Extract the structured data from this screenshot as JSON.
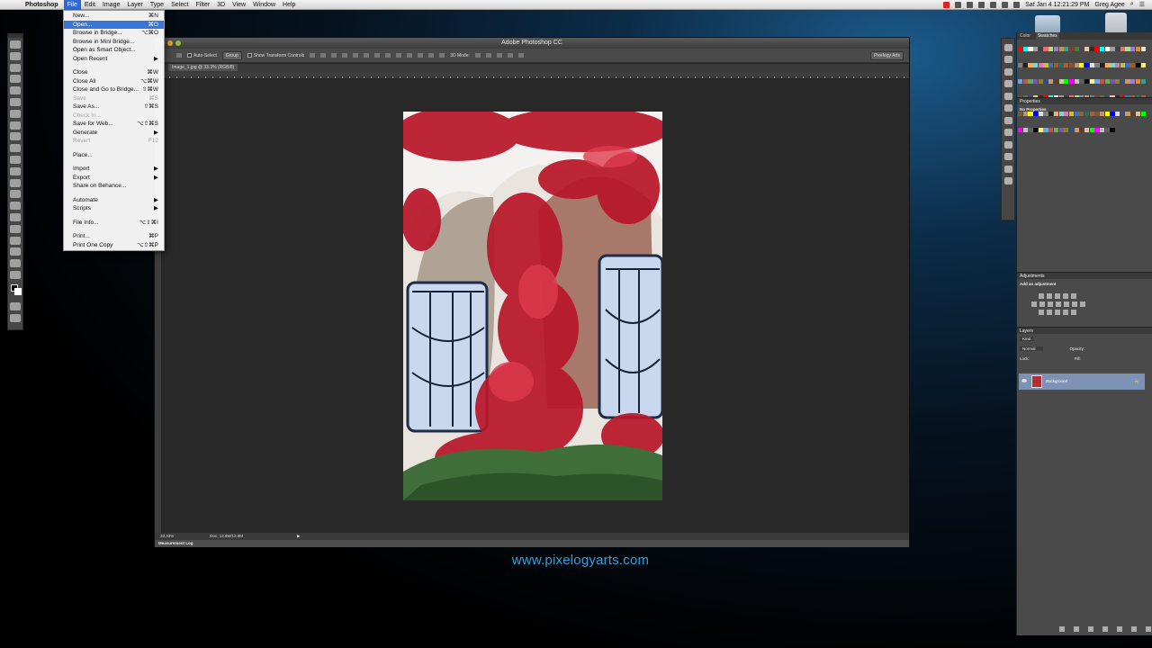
{
  "menubar": {
    "app_name": "Photoshop",
    "items": [
      "File",
      "Edit",
      "Image",
      "Layer",
      "Type",
      "Select",
      "Filter",
      "3D",
      "View",
      "Window",
      "Help"
    ],
    "datetime": "Sat Jan 4  12:21:29 PM",
    "user": "Greg Agee"
  },
  "file_menu": [
    {
      "label": "New...",
      "shortcut": "⌘N"
    },
    {
      "label": "Open...",
      "shortcut": "⌘O",
      "selected": true
    },
    {
      "label": "Browse in Bridge...",
      "shortcut": "⌥⌘O"
    },
    {
      "label": "Browse in Mini Bridge...",
      "shortcut": ""
    },
    {
      "label": "Open as Smart Object...",
      "shortcut": ""
    },
    {
      "label": "Open Recent",
      "shortcut": "▶"
    },
    {
      "separator": true
    },
    {
      "label": "Close",
      "shortcut": "⌘W"
    },
    {
      "label": "Close All",
      "shortcut": "⌥⌘W"
    },
    {
      "label": "Close and Go to Bridge...",
      "shortcut": "⇧⌘W"
    },
    {
      "label": "Save",
      "shortcut": "⌘S",
      "disabled": true
    },
    {
      "label": "Save As...",
      "shortcut": "⇧⌘S"
    },
    {
      "label": "Check In...",
      "shortcut": "",
      "disabled": true
    },
    {
      "label": "Save for Web...",
      "shortcut": "⌥⇧⌘S"
    },
    {
      "label": "Generate",
      "shortcut": "▶"
    },
    {
      "label": "Revert",
      "shortcut": "F12",
      "disabled": true
    },
    {
      "separator": true
    },
    {
      "label": "Place...",
      "shortcut": ""
    },
    {
      "separator": true
    },
    {
      "label": "Import",
      "shortcut": "▶"
    },
    {
      "label": "Export",
      "shortcut": "▶"
    },
    {
      "label": "Share on Behance...",
      "shortcut": ""
    },
    {
      "separator": true
    },
    {
      "label": "Automate",
      "shortcut": "▶"
    },
    {
      "label": "Scripts",
      "shortcut": "▶"
    },
    {
      "separator": true
    },
    {
      "label": "File Info...",
      "shortcut": "⌥⇧⌘I"
    },
    {
      "separator": true
    },
    {
      "label": "Print...",
      "shortcut": "⌘P"
    },
    {
      "label": "Print One Copy",
      "shortcut": "⌥⇧⌘P"
    }
  ],
  "window": {
    "title": "Adobe Photoshop CC",
    "options": {
      "auto_select": "Auto-Select",
      "group": "Group",
      "transform": "Show Transform Controls",
      "mode3d": "3D Mode:",
      "workspace": "Pixelogy Arts"
    },
    "doc_tab": "Image_1.jpg @ 33.3% (RGB/8)",
    "zoom": "33.33%",
    "doc_size": "Doc: 12.8M/12.8M",
    "measurement_log": "Measurement Log"
  },
  "panels": {
    "color_tabs": [
      "Color",
      "Swatches"
    ],
    "properties_title": "Properties",
    "properties_text": "No Properties",
    "adjustments_title": "Adjustments",
    "adjustments_text": "Add an adjustment",
    "layers_title": "Layers",
    "layers_kind": "Kind",
    "layers_blend": "Normal",
    "layers_opacity": "Opacity:",
    "layers_lock": "Lock:",
    "layers_fill": "Fill:",
    "layer_name": "Background"
  },
  "website": "www.pixelogyarts.com"
}
